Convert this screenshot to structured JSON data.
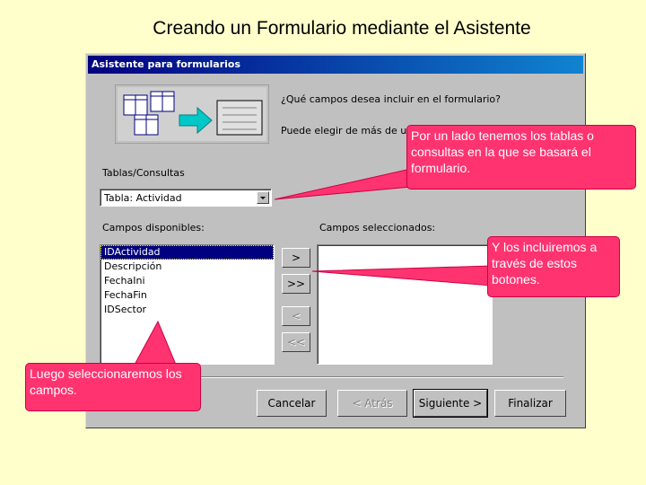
{
  "slide": {
    "title": "Creando un Formulario mediante el Asistente"
  },
  "dialog": {
    "title": "Asistente para formularios",
    "question": "¿Qué campos desea incluir en el formulario?",
    "hint": "Puede elegir de más de una",
    "tables_label": "Tablas/Consultas",
    "tables_value": "Tabla: Actividad",
    "available_label": "Campos disponibles:",
    "selected_label": "Campos seleccionados:",
    "available_fields": [
      "IDActividad",
      "Descripción",
      "FechaIni",
      "FechaFin",
      "IDSector"
    ],
    "selected_fields": [],
    "move_buttons": {
      "add": ">",
      "add_all": ">>",
      "remove": "<",
      "remove_all": "<<"
    },
    "footer_buttons": {
      "cancel": "Cancelar",
      "back": "< Atrás",
      "next": "Siguiente >",
      "finish": "Finalizar"
    }
  },
  "callouts": {
    "tables": "Por un lado tenemos los tablas o consultas en la que se basará el formulario.",
    "buttons": "Y los incluiremos a través de estos botones.",
    "fields": "Luego seleccionaremos los campos."
  },
  "colors": {
    "background": "#ffffcc",
    "callout": "#ff3370",
    "dialog": "#c0c0c0",
    "titlebar": "#000080"
  }
}
